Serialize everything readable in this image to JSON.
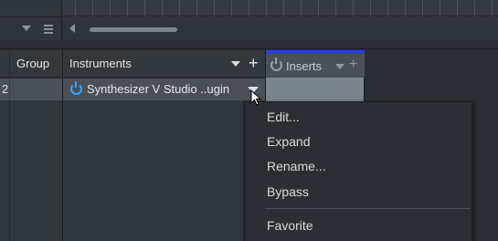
{
  "mixer": {
    "columns": {
      "group": "Group",
      "instruments": "Instruments",
      "inserts": "Inserts"
    },
    "channel": {
      "number": "2",
      "instrument": "Synthesizer V Studio ..ugin"
    }
  },
  "context_menu": {
    "items": [
      {
        "label": "Edit..."
      },
      {
        "label": "Expand"
      },
      {
        "label": "Rename..."
      },
      {
        "label": "Bypass"
      },
      {
        "label": "Favorite"
      }
    ]
  },
  "colors": {
    "accent_blue": "#2f40d6",
    "power_on": "#3aa0ff"
  }
}
